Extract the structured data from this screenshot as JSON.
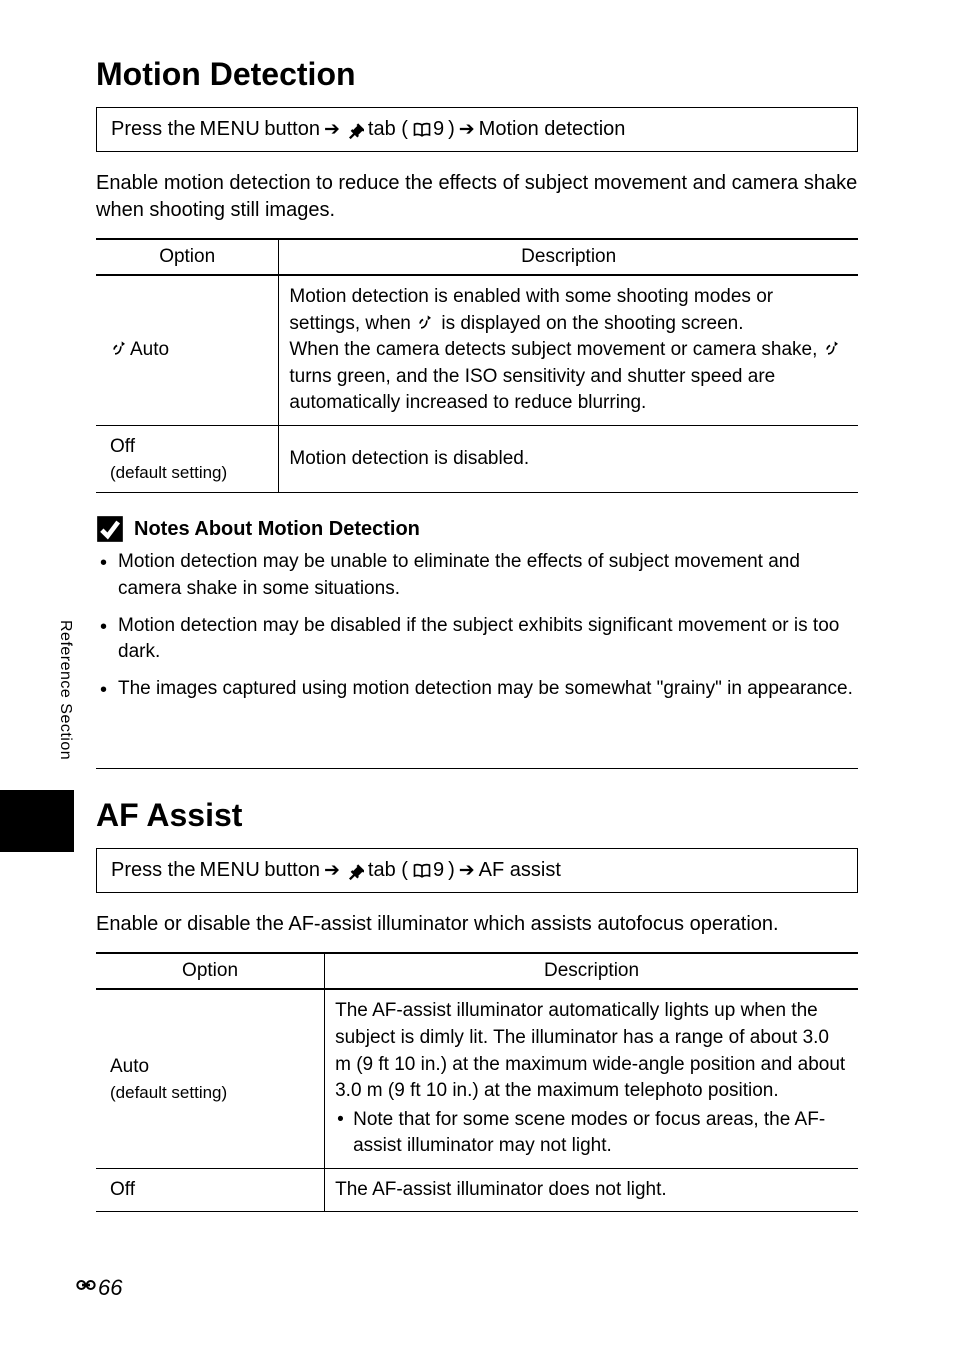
{
  "sideTab": "Reference Section",
  "pageNumber": "66",
  "arrow": "➔",
  "bookRef": "9",
  "headers": {
    "option": "Option",
    "description": "Description"
  },
  "motion": {
    "title": "Motion Detection",
    "nav": {
      "prefix": "Press the ",
      "menuWord": "MENU",
      "afterMenu": " button ",
      "tabWord": " tab (",
      "closeParen": ") ",
      "target": " Motion detection"
    },
    "intro": "Enable motion detection to reduce the effects of subject movement and camera shake when shooting still images.",
    "rows": [
      {
        "option": "Auto",
        "optionPrefixIcon": "motion-icon",
        "desc_a": "Motion detection is enabled with some shooting modes or settings, when ",
        "desc_b": " is displayed on the shooting screen.",
        "desc_c": "When the camera detects subject movement or camera shake, ",
        "desc_d": " turns green, and the ISO sensitivity and shutter speed are automatically increased to reduce blurring."
      },
      {
        "option": "Off",
        "optionSub": "(default setting)",
        "desc": "Motion detection is disabled."
      }
    ],
    "notesTitle": "Notes About Motion Detection",
    "notes": [
      "Motion detection may be unable to eliminate the effects of subject movement and camera shake in some situations.",
      "Motion detection may be disabled if the subject exhibits significant movement or is too dark.",
      "The images captured using motion detection may be somewhat \"grainy\" in appearance."
    ]
  },
  "af": {
    "title": "AF Assist",
    "nav": {
      "prefix": "Press the ",
      "menuWord": "MENU",
      "afterMenu": " button ",
      "tabWord": " tab (",
      "closeParen": ") ",
      "target": " AF assist"
    },
    "intro": "Enable or disable the AF-assist illuminator which assists autofocus operation.",
    "rows": [
      {
        "option": "Auto",
        "optionSub": "(default setting)",
        "desc_main": "The AF-assist illuminator automatically lights up when the subject is dimly lit. The illuminator has a range of about 3.0 m (9 ft 10 in.) at the maximum wide-angle position and about 3.0 m (9 ft 10 in.) at the maximum telephoto position.",
        "desc_bullet": "Note that for some scene modes or focus areas, the AF-assist illuminator may not light."
      },
      {
        "option": "Off",
        "desc": "The AF-assist illuminator does not light."
      }
    ]
  }
}
